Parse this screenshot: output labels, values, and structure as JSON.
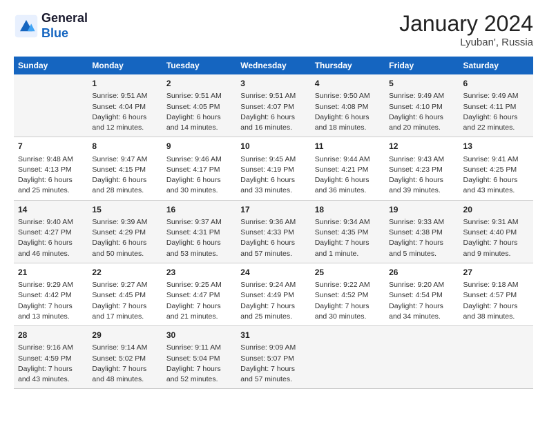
{
  "header": {
    "logo_line1": "General",
    "logo_line2": "Blue",
    "month": "January 2024",
    "location": "Lyuban', Russia"
  },
  "days_of_week": [
    "Sunday",
    "Monday",
    "Tuesday",
    "Wednesday",
    "Thursday",
    "Friday",
    "Saturday"
  ],
  "weeks": [
    [
      {
        "num": "",
        "info": ""
      },
      {
        "num": "1",
        "info": "Sunrise: 9:51 AM\nSunset: 4:04 PM\nDaylight: 6 hours\nand 12 minutes."
      },
      {
        "num": "2",
        "info": "Sunrise: 9:51 AM\nSunset: 4:05 PM\nDaylight: 6 hours\nand 14 minutes."
      },
      {
        "num": "3",
        "info": "Sunrise: 9:51 AM\nSunset: 4:07 PM\nDaylight: 6 hours\nand 16 minutes."
      },
      {
        "num": "4",
        "info": "Sunrise: 9:50 AM\nSunset: 4:08 PM\nDaylight: 6 hours\nand 18 minutes."
      },
      {
        "num": "5",
        "info": "Sunrise: 9:49 AM\nSunset: 4:10 PM\nDaylight: 6 hours\nand 20 minutes."
      },
      {
        "num": "6",
        "info": "Sunrise: 9:49 AM\nSunset: 4:11 PM\nDaylight: 6 hours\nand 22 minutes."
      }
    ],
    [
      {
        "num": "7",
        "info": "Sunrise: 9:48 AM\nSunset: 4:13 PM\nDaylight: 6 hours\nand 25 minutes."
      },
      {
        "num": "8",
        "info": "Sunrise: 9:47 AM\nSunset: 4:15 PM\nDaylight: 6 hours\nand 28 minutes."
      },
      {
        "num": "9",
        "info": "Sunrise: 9:46 AM\nSunset: 4:17 PM\nDaylight: 6 hours\nand 30 minutes."
      },
      {
        "num": "10",
        "info": "Sunrise: 9:45 AM\nSunset: 4:19 PM\nDaylight: 6 hours\nand 33 minutes."
      },
      {
        "num": "11",
        "info": "Sunrise: 9:44 AM\nSunset: 4:21 PM\nDaylight: 6 hours\nand 36 minutes."
      },
      {
        "num": "12",
        "info": "Sunrise: 9:43 AM\nSunset: 4:23 PM\nDaylight: 6 hours\nand 39 minutes."
      },
      {
        "num": "13",
        "info": "Sunrise: 9:41 AM\nSunset: 4:25 PM\nDaylight: 6 hours\nand 43 minutes."
      }
    ],
    [
      {
        "num": "14",
        "info": "Sunrise: 9:40 AM\nSunset: 4:27 PM\nDaylight: 6 hours\nand 46 minutes."
      },
      {
        "num": "15",
        "info": "Sunrise: 9:39 AM\nSunset: 4:29 PM\nDaylight: 6 hours\nand 50 minutes."
      },
      {
        "num": "16",
        "info": "Sunrise: 9:37 AM\nSunset: 4:31 PM\nDaylight: 6 hours\nand 53 minutes."
      },
      {
        "num": "17",
        "info": "Sunrise: 9:36 AM\nSunset: 4:33 PM\nDaylight: 6 hours\nand 57 minutes."
      },
      {
        "num": "18",
        "info": "Sunrise: 9:34 AM\nSunset: 4:35 PM\nDaylight: 7 hours\nand 1 minute."
      },
      {
        "num": "19",
        "info": "Sunrise: 9:33 AM\nSunset: 4:38 PM\nDaylight: 7 hours\nand 5 minutes."
      },
      {
        "num": "20",
        "info": "Sunrise: 9:31 AM\nSunset: 4:40 PM\nDaylight: 7 hours\nand 9 minutes."
      }
    ],
    [
      {
        "num": "21",
        "info": "Sunrise: 9:29 AM\nSunset: 4:42 PM\nDaylight: 7 hours\nand 13 minutes."
      },
      {
        "num": "22",
        "info": "Sunrise: 9:27 AM\nSunset: 4:45 PM\nDaylight: 7 hours\nand 17 minutes."
      },
      {
        "num": "23",
        "info": "Sunrise: 9:25 AM\nSunset: 4:47 PM\nDaylight: 7 hours\nand 21 minutes."
      },
      {
        "num": "24",
        "info": "Sunrise: 9:24 AM\nSunset: 4:49 PM\nDaylight: 7 hours\nand 25 minutes."
      },
      {
        "num": "25",
        "info": "Sunrise: 9:22 AM\nSunset: 4:52 PM\nDaylight: 7 hours\nand 30 minutes."
      },
      {
        "num": "26",
        "info": "Sunrise: 9:20 AM\nSunset: 4:54 PM\nDaylight: 7 hours\nand 34 minutes."
      },
      {
        "num": "27",
        "info": "Sunrise: 9:18 AM\nSunset: 4:57 PM\nDaylight: 7 hours\nand 38 minutes."
      }
    ],
    [
      {
        "num": "28",
        "info": "Sunrise: 9:16 AM\nSunset: 4:59 PM\nDaylight: 7 hours\nand 43 minutes."
      },
      {
        "num": "29",
        "info": "Sunrise: 9:14 AM\nSunset: 5:02 PM\nDaylight: 7 hours\nand 48 minutes."
      },
      {
        "num": "30",
        "info": "Sunrise: 9:11 AM\nSunset: 5:04 PM\nDaylight: 7 hours\nand 52 minutes."
      },
      {
        "num": "31",
        "info": "Sunrise: 9:09 AM\nSunset: 5:07 PM\nDaylight: 7 hours\nand 57 minutes."
      },
      {
        "num": "",
        "info": ""
      },
      {
        "num": "",
        "info": ""
      },
      {
        "num": "",
        "info": ""
      }
    ]
  ]
}
